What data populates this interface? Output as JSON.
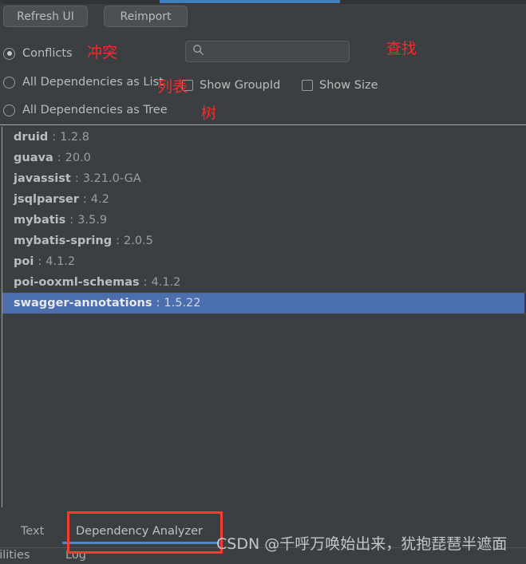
{
  "toolbar": {
    "refresh_label": "Refresh UI",
    "reimport_label": "Reimport"
  },
  "view_options": {
    "conflicts_label": "Conflicts",
    "list_label": "All Dependencies as List",
    "tree_label": "All Dependencies as Tree",
    "selected": "Conflicts"
  },
  "search": {
    "value": "",
    "placeholder": "",
    "icon": "search-icon"
  },
  "checkboxes": [
    {
      "label": "Show GroupId",
      "checked": false
    },
    {
      "label": "Show Size",
      "checked": false
    }
  ],
  "dependencies": [
    {
      "name": "druid",
      "separator": ":",
      "version": "1.2.8",
      "selected": false
    },
    {
      "name": "guava",
      "separator": ":",
      "version": "20.0",
      "selected": false
    },
    {
      "name": "javassist",
      "separator": ":",
      "version": "3.21.0-GA",
      "selected": false
    },
    {
      "name": "jsqlparser",
      "separator": ":",
      "version": "4.2",
      "selected": false
    },
    {
      "name": "mybatis",
      "separator": ":",
      "version": "3.5.9",
      "selected": false
    },
    {
      "name": "mybatis-spring",
      "separator": ":",
      "version": "2.0.5",
      "selected": false
    },
    {
      "name": "poi",
      "separator": ":",
      "version": "4.1.2",
      "selected": false
    },
    {
      "name": "poi-ooxml-schemas",
      "separator": ":",
      "version": "4.1.2",
      "selected": false
    },
    {
      "name": "swagger-annotations",
      "separator": ":",
      "version": "1.5.22",
      "selected": true
    }
  ],
  "tabs": {
    "text_label": "Text",
    "dependency_analyzer_label": "Dependency Analyzer",
    "active": "Dependency Analyzer"
  },
  "bottom_bar": {
    "vulnerabilities_label": "bilities",
    "log_label": "Log"
  },
  "annotations": {
    "conflict": "冲突",
    "list": "列表",
    "tree": "树",
    "find": "查找"
  },
  "watermark": {
    "text": "CSDN @千呼万唤始出来，犹抱琵琶半遮面"
  },
  "colors": {
    "background": "#3c3f41",
    "selection_blue": "#4b6eaf",
    "tab_underline_blue": "#4a88c7",
    "top_bar_blue": "#3d7ebc",
    "annotation_red": "#fb2a2a",
    "text_primary": "#bbbbbb",
    "text_dim": "#9b9fa1"
  }
}
